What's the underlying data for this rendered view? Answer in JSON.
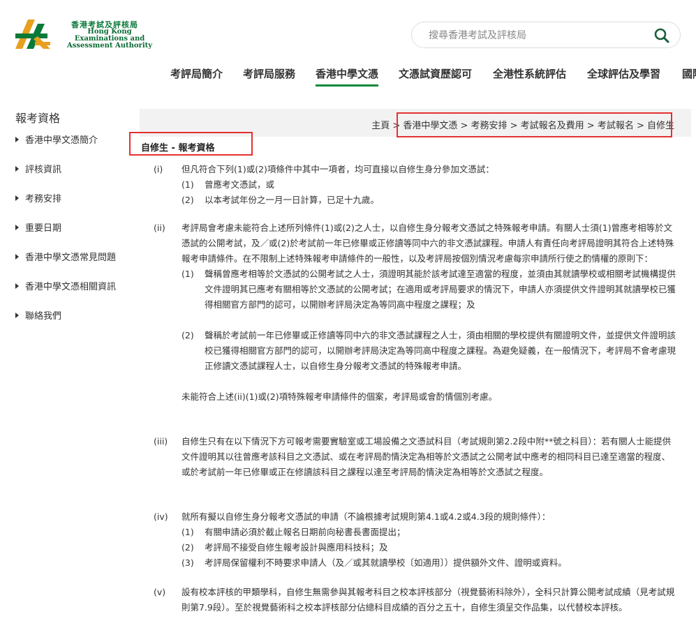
{
  "header": {
    "logo_zh": "香港考試及評核局",
    "logo_en": [
      "Hong Kong",
      "Examinations and",
      "Assessment Authority"
    ],
    "search_placeholder": "搜尋香港考試及評核局"
  },
  "nav": [
    "考評局簡介",
    "考評局服務",
    "香港中學文憑",
    "文憑試資歷認可",
    "全港性系統評估",
    "全球評估及學習",
    "國際"
  ],
  "nav_active": "香港中學文憑",
  "sidebar": {
    "title": "報考資格",
    "items": [
      "香港中學文憑簡介",
      "評核資訊",
      "考務安排",
      "重要日期",
      "香港中學文憑常見問題",
      "香港中學文憑相關資訊",
      "聯絡我們"
    ]
  },
  "breadcrumb": "主頁 > 香港中學文憑 > 考務安排 > 考試報名及費用 > 考試報名 > 自修生",
  "page_title": "自修生 - 報考資格",
  "content": {
    "i": {
      "num": "(i)",
      "intro": "但凡符合下列(1)或(2)項條件中其中一項者，均可直接以自修生身分參加文憑試：",
      "s1": "曾應考文憑試，或",
      "s2": "以本考試年份之一月一日計算，已足十九歲。"
    },
    "ii": {
      "num": "(ii)",
      "intro": "考評局會考慮未能符合上述所列條件(1)或(2)之人士，以自修生身分報考文憑試之特殊報考申請。有關人士須(1)曾應考相等於文憑試的公開考試，及／或(2)於考試前一年已修畢或正修讀等同中六的非文憑試課程。申請人有責任向考評局證明其符合上述特殊報考申請條件。在不限制上述特殊報考申請條件的一般性，以及考評局按個別情況考慮每宗申請所行使之酌情權的原則下：",
      "s1": "聲稱曾應考相等於文憑試的公開考試之人士，須證明其能於該考試達至適當的程度，並須由其就讀學校或相關考試機構提供文件證明其已應考有關相等於文憑試的公開考試；在適用或考評局要求的情況下，申請人亦須提供文件證明其就讀學校已獲得相關官方部門的認可，以開辦考評局決定為等同高中程度之課程；及",
      "s2": "聲稱於考試前一年已修畢或正修讀等同中六的非文憑試課程之人士，須由相關的學校提供有關證明文件，並提供文件證明該校已獲得相關官方部門的認可，以開辦考評局決定為等同高中程度之課程。為避免疑義，在一般情況下，考評局不會考慮現正修讀文憑試課程人士，以自修生身分報考文憑試的特殊報考申請。",
      "note": "未能符合上述(ii)(1)或(2)項特殊報考申請條件的個案，考評局或會酌情個別考慮。"
    },
    "iii": {
      "num": "(iii)",
      "text": "自修生只有在以下情況下方可報考需要實驗室或工場設備之文憑試科目（考試規則第2.2段中附**號之科目）：若有關人士能提供文件證明其以往曾應考該科目之文憑試、或在考評局酌情決定為相等於文憑試之公開考試中應考的相同科目已達至適當的程度、或於考試前一年已修畢或正在修讀該科目之課程以達至考評局酌情決定為相等於文憑試之程度。"
    },
    "iv": {
      "num": "(iv)",
      "intro": "就所有擬以自修生身分報考文憑試的申請（不論根據考試規則第4.1或4.2或4.3段的規則條件）：",
      "s1": "有關申請必須於截止報名日期前向秘書長書面提出；",
      "s2": "考評局不接受自修生報考設計與應用科技科；及",
      "s3": "考評局保留權利不時要求申請人（及／或其就讀學校〔如適用〕）提供額外文件、證明或資料。"
    },
    "v": {
      "num": "(v)",
      "text": "設有校本評核的甲類學科，自修生無需參與其報考科目之校本評核部分（視覺藝術科除外），全科只計算公開考試成績（見考試規則第7.9段）。至於視覺藝術科之校本評核部分佔總科目成績的百分之五十，自修生須呈交作品集，以代替校本評核。"
    }
  },
  "sub_nums": [
    "(1)",
    "(2)",
    "(3)"
  ],
  "colors": {
    "accent": "#0a8a3a",
    "highlight": "#e53030",
    "crumb_bg": "#f2f2f2"
  }
}
